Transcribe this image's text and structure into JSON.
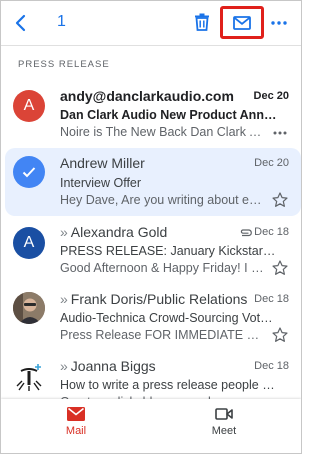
{
  "toolbar": {
    "selected_count": "1"
  },
  "section_label": "PRESS RELEASE",
  "emails": [
    {
      "avatar_letter": "A",
      "avatar_color": "#db4437",
      "sender": "andy@danclarkaudio.com",
      "date": "Dec 20",
      "subject": "Dan Clark Audio New Product Anno…",
      "snippet": "Noire is The New Back Dan Clark Audi…",
      "unread": true
    },
    {
      "avatar_icon": "check-icon",
      "avatar_color": "#4285f4",
      "sender": "Andrew Miller",
      "date": "Dec 20",
      "subject": "Interview Offer",
      "snippet": "Hey Dave, Are you writing about entre…",
      "selected": true
    },
    {
      "avatar_letter": "A",
      "avatar_color": "#1a4fa3",
      "sender": "Alexandra Gold",
      "date": "Dec 18",
      "subject": "PRESS RELEASE: January Kickstarter…",
      "snippet": "Good Afternoon & Happy Friday! I am…",
      "has_attachment": true
    },
    {
      "avatar_icon": "photo-avatar",
      "sender": "Frank Doris/Public Relations",
      "date": "Dec 18",
      "subject": "Audio-Technica Crowd-Sourcing Vote…",
      "snippet": "Press Release FOR IMMEDIATE RELE…"
    },
    {
      "avatar_icon": "logo-avatar",
      "sender": "Joanna Biggs",
      "date": "Dec 18",
      "subject": "How to write a press release people w…",
      "snippet": "Create a clickable press release and p…"
    }
  ],
  "nav": {
    "mail_label": "Mail",
    "meet_label": "Meet"
  },
  "colors": {
    "accent": "#1a73e8",
    "mail_active": "#d93025",
    "highlight_box": "#e0201b",
    "selected_row": "#e8f0fe"
  }
}
